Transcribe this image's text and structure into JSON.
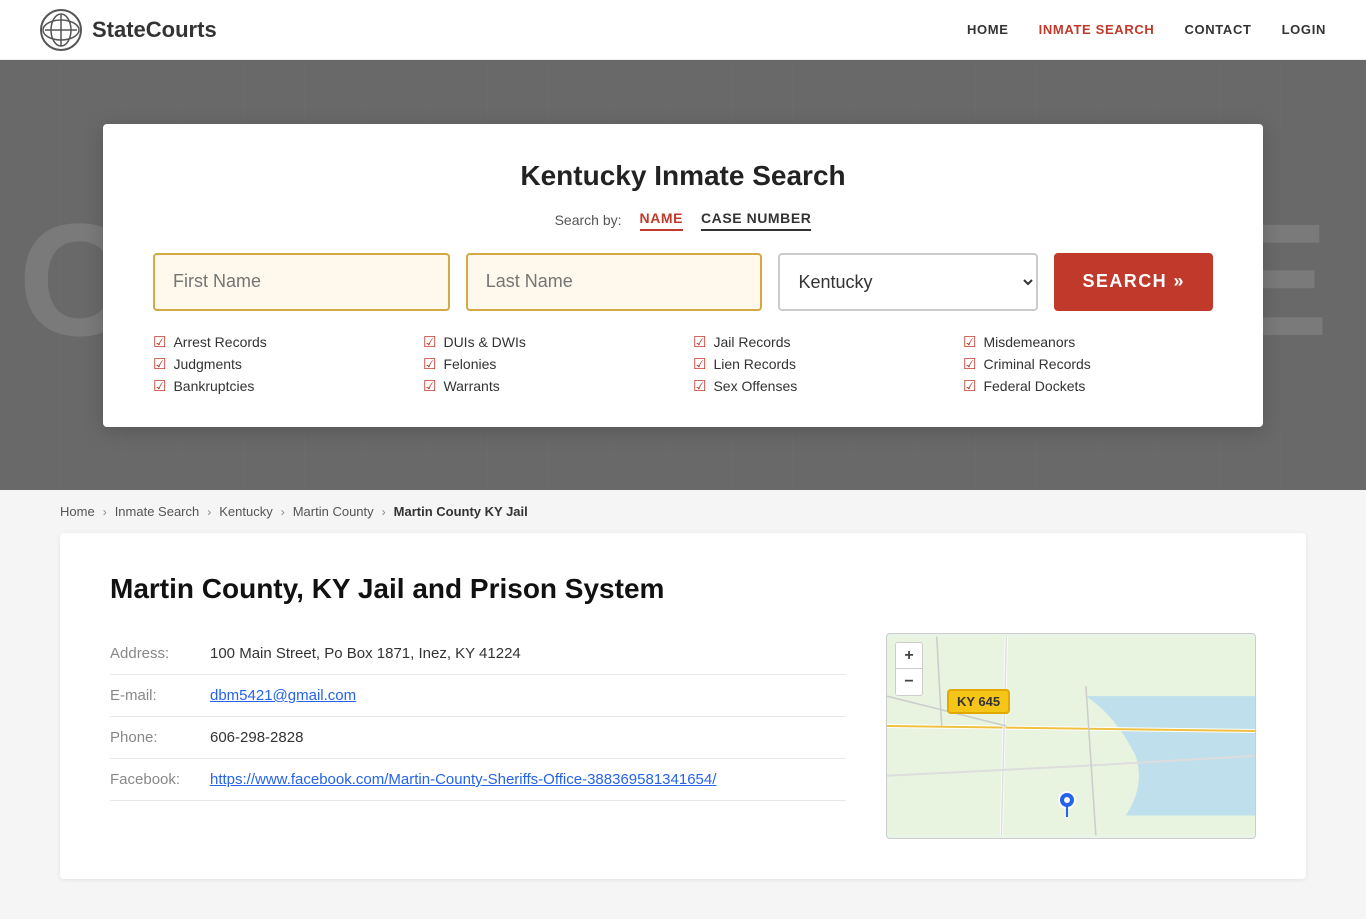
{
  "header": {
    "logo_text": "StateCourts",
    "nav": [
      {
        "label": "HOME",
        "active": false
      },
      {
        "label": "INMATE SEARCH",
        "active": true
      },
      {
        "label": "CONTACT",
        "active": false
      },
      {
        "label": "LOGIN",
        "active": false
      }
    ]
  },
  "hero": {
    "background_text": "COURTHOUSE"
  },
  "search_card": {
    "title": "Kentucky Inmate Search",
    "search_by_label": "Search by:",
    "tabs": [
      {
        "label": "NAME",
        "active": true
      },
      {
        "label": "CASE NUMBER",
        "active": false
      }
    ],
    "first_name_placeholder": "First Name",
    "last_name_placeholder": "Last Name",
    "state_value": "Kentucky",
    "search_button": "SEARCH »",
    "checkboxes": [
      "Arrest Records",
      "Judgments",
      "Bankruptcies",
      "DUIs & DWIs",
      "Felonies",
      "Warrants",
      "Jail Records",
      "Lien Records",
      "Sex Offenses",
      "Misdemeanors",
      "Criminal Records",
      "Federal Dockets"
    ]
  },
  "breadcrumb": {
    "items": [
      "Home",
      "Inmate Search",
      "Kentucky",
      "Martin County"
    ],
    "current": "Martin County KY Jail"
  },
  "main": {
    "title": "Martin County, KY Jail and Prison System",
    "info": {
      "address_label": "Address:",
      "address_value": "100 Main Street, Po Box 1871, Inez, KY 41224",
      "email_label": "E-mail:",
      "email_value": "dbm5421@gmail.com",
      "phone_label": "Phone:",
      "phone_value": "606-298-2828",
      "facebook_label": "Facebook:",
      "facebook_url": "https://www.facebook.com/Martin-County-Sheriffs-Office-388369581341654/",
      "facebook_display": "https://www.facebook.com/Martin-County-Sheriffs-Office-388369581341654/"
    }
  },
  "map": {
    "zoom_in": "+",
    "zoom_out": "−",
    "badge_text": "KY 645"
  }
}
